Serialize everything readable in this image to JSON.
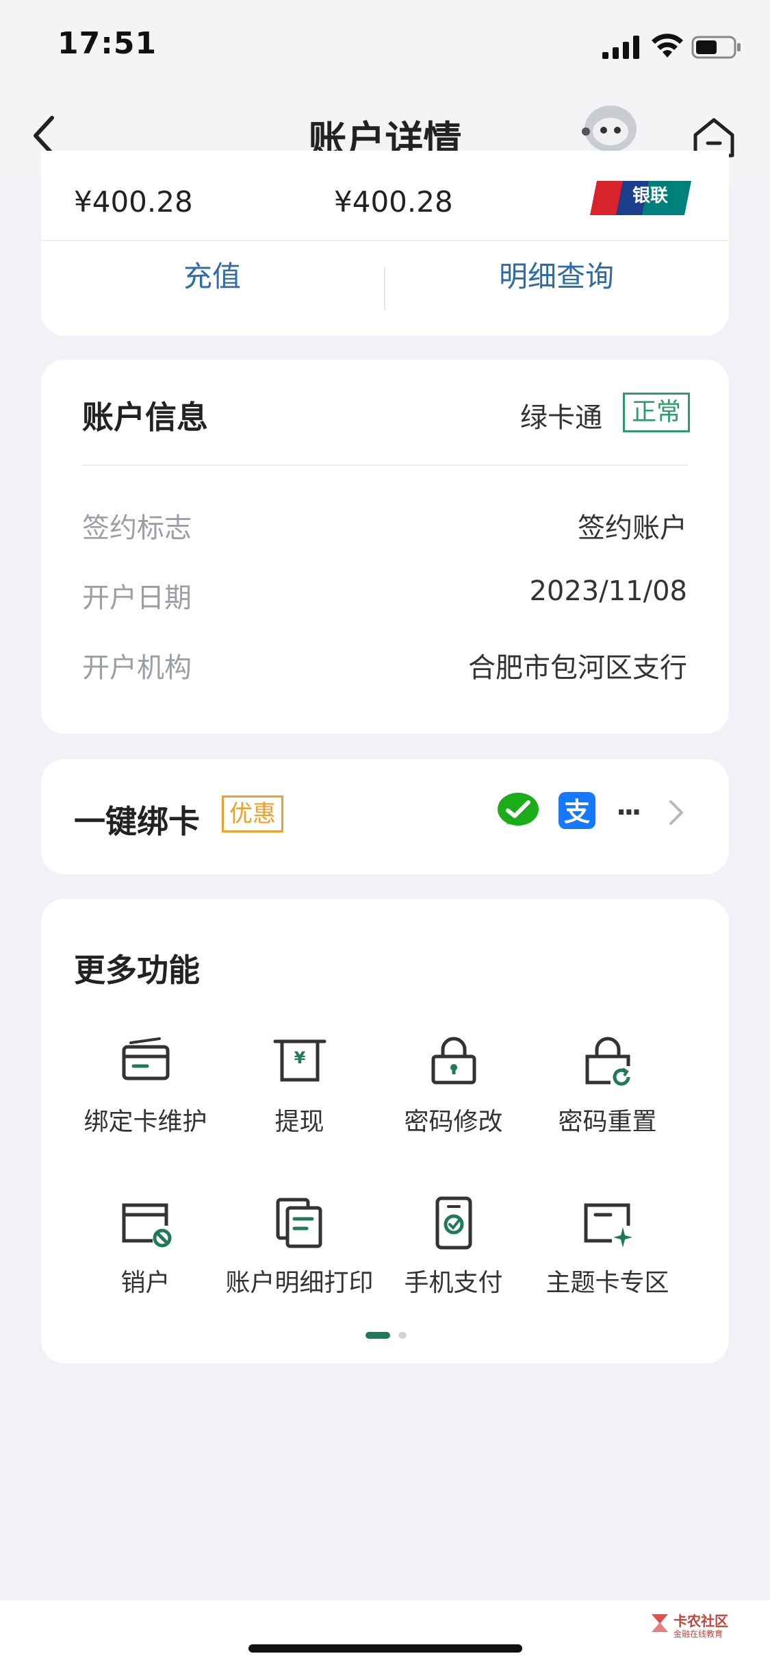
{
  "status_bar": {
    "time": "17:51"
  },
  "nav": {
    "title": "账户详情"
  },
  "balance": {
    "amount_left": "¥400.28",
    "amount_right": "¥400.28",
    "card_brand": "银联"
  },
  "top_actions": {
    "recharge": "充值",
    "details": "明细查询"
  },
  "account_info": {
    "title": "账户信息",
    "product": "绿卡通",
    "status": "正常",
    "rows": [
      {
        "label": "签约标志",
        "value": "签约账户"
      },
      {
        "label": "开户日期",
        "value": "2023/11/08"
      },
      {
        "label": "开户机构",
        "value": "合肥市包河区支行"
      }
    ]
  },
  "bind_card": {
    "title": "一键绑卡",
    "badge": "优惠",
    "more": "···"
  },
  "more_functions": {
    "title": "更多功能",
    "items": [
      {
        "label": "绑定卡维护",
        "icon": "card-icon"
      },
      {
        "label": "提现",
        "icon": "withdraw-icon"
      },
      {
        "label": "密码修改",
        "icon": "lock-icon"
      },
      {
        "label": "密码重置",
        "icon": "lock-reset-icon"
      },
      {
        "label": "销户",
        "icon": "close-account-icon"
      },
      {
        "label": "账户明细打印",
        "icon": "print-statement-icon"
      },
      {
        "label": "手机支付",
        "icon": "mobile-pay-icon"
      },
      {
        "label": "主题卡专区",
        "icon": "theme-card-icon"
      }
    ],
    "page_count": 2,
    "current_page": 1
  },
  "watermark": {
    "text": "卡农社区",
    "sub": "金融在线教育"
  },
  "colors": {
    "accent_green": "#1f7a55",
    "link_blue": "#2d6ca8",
    "badge_orange": "#f0a02a"
  }
}
